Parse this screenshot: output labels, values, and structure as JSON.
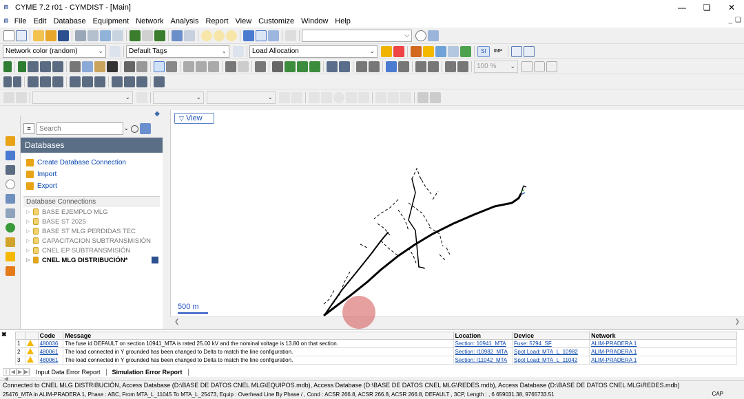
{
  "window": {
    "title": "CYME 7.2 r01 - CYMDIST - [Main]",
    "app_icon_text": "ᗰ"
  },
  "menu": [
    "File",
    "Edit",
    "Database",
    "Equipment",
    "Network",
    "Analysis",
    "Report",
    "View",
    "Customize",
    "Window",
    "Help"
  ],
  "toolbar2": {
    "network_color": "Network color (random)",
    "tags": "Default Tags",
    "load_allocation": "Load Allocation",
    "si_label": "SI",
    "imp_label": "IMP",
    "zoom": "100 %"
  },
  "sidebar": {
    "search_placeholder": "Search",
    "header": "Databases",
    "actions": [
      "Create Database Connection",
      "Import",
      "Export"
    ],
    "connections_title": "Database Connections",
    "connections": [
      {
        "label": "BASE EJEMPLO MLG",
        "active": false
      },
      {
        "label": "BASE ST 2025",
        "active": false
      },
      {
        "label": "BASE ST MLG PERDIDAS TEC",
        "active": false
      },
      {
        "label": "CAPACITACION SUBTRANSMISIÓN",
        "active": false
      },
      {
        "label": "CNEL EP SUBTRANSMISIÓN",
        "active": false
      },
      {
        "label": "CNEL MLG DISTRIBUCIÓN*",
        "active": true
      }
    ]
  },
  "map": {
    "view_tab": "View",
    "scale_label": "500 m"
  },
  "errors": {
    "columns": [
      "",
      "",
      "Code",
      "Message",
      "Location",
      "Device",
      "Network"
    ],
    "rows": [
      {
        "n": "1",
        "code": "480036",
        "message": "The fuse id DEFAULT on section 10941_MTA is rated 25.00 kV and the nominal voltage is 13.80 on that section.",
        "location": "Section: 10941_MTA",
        "device": "Fuse: 5794_SF",
        "network": "ALIM-PRADERA 1"
      },
      {
        "n": "2",
        "code": "480061",
        "message": "The load connected in Y grounded has been changed to Delta to match the line configuration.",
        "location": "Section: I10982_MTA",
        "device": "Spot Load: MTA_L_10982",
        "network": "ALIM-PRADERA 1"
      },
      {
        "n": "3",
        "code": "480061",
        "message": "The load connected in Y grounded has been changed to Delta to match the line configuration.",
        "location": "Section: I11042_MTA",
        "device": "Spot Load: MTA_L_11042",
        "network": "ALIM-PRADERA 1"
      }
    ],
    "tabs": [
      "Input Data Error Report",
      "Simulation Error Report"
    ]
  },
  "status": {
    "line1": "Connected to CNEL MLG DISTRIBUCIÓN, Access Database (D:\\BASE DE DATOS CNEL MLG\\EQUIPOS.mdb), Access Database (D:\\BASE DE DATOS CNEL MLG\\REDES.mdb), Access Database (D:\\BASE DE DATOS CNEL MLG\\REDES.mdb)",
    "line2": "25476_MTA in ALIM-PRADERA 1, Phase : ABC, From MTA_L_11045 To MTA_L_25473, Equip : Overhead Line By Phase / , Cond : ACSR 266.8, ACSR 266.8, ACSR 266.8, DEFAULT , 3CP, Length : , 6 659031.38, 9765733.51",
    "cap": "CAP"
  }
}
